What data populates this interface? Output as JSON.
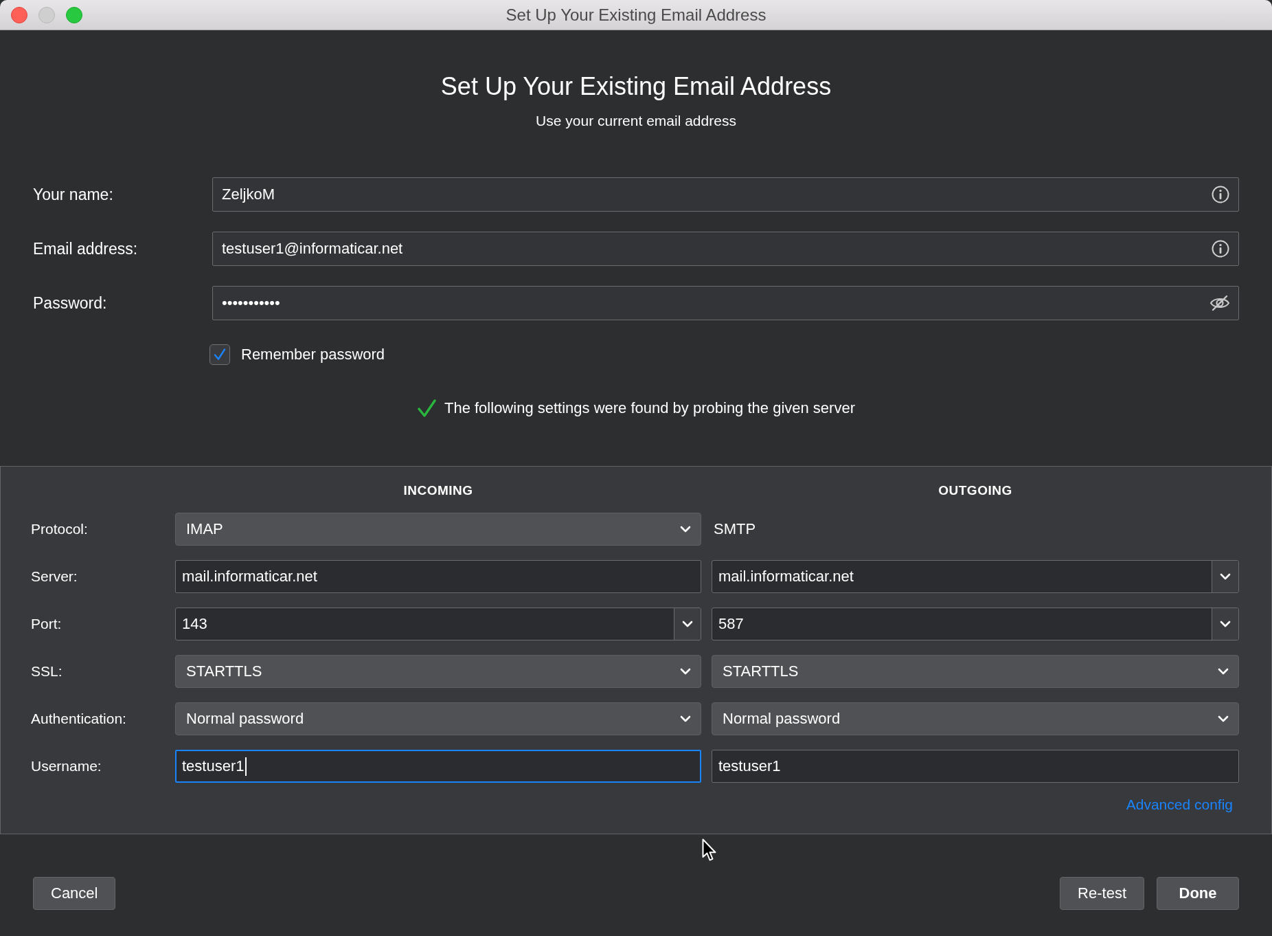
{
  "window": {
    "title": "Set Up Your Existing Email Address"
  },
  "header": {
    "title": "Set Up Your Existing Email Address",
    "subtitle": "Use your current email address"
  },
  "fields": [
    {
      "label": "Your name:",
      "kind": "text",
      "value": "ZeljkoM"
    },
    {
      "label": "Email address:",
      "kind": "text",
      "value": "testuser1@informaticar.net"
    },
    {
      "label": "Password:",
      "kind": "password",
      "value": "•••••••••••"
    }
  ],
  "remember_password": {
    "label": "Remember password",
    "checked": true
  },
  "status_message": {
    "text": "The following settings were found by probing the given server",
    "kind": "success"
  },
  "server_settings": {
    "columns": [
      {
        "heading": "INCOMING"
      },
      {
        "heading": "OUTGOING"
      }
    ],
    "rows": [
      {
        "label": "Protocol:",
        "incoming": {
          "kind": "select",
          "value": "IMAP"
        },
        "outgoing": {
          "kind": "plain",
          "value": "SMTP"
        }
      },
      {
        "label": "Server:",
        "incoming": {
          "kind": "text",
          "value": "mail.informaticar.net",
          "focused": false
        },
        "outgoing": {
          "kind": "combo",
          "value": "mail.informaticar.net"
        }
      },
      {
        "label": "Port:",
        "incoming": {
          "kind": "combo",
          "value": "143"
        },
        "outgoing": {
          "kind": "combo",
          "value": "587"
        }
      },
      {
        "label": "SSL:",
        "incoming": {
          "kind": "select",
          "value": "STARTTLS"
        },
        "outgoing": {
          "kind": "select",
          "value": "STARTTLS"
        }
      },
      {
        "label": "Authentication:",
        "incoming": {
          "kind": "select",
          "value": "Normal password"
        },
        "outgoing": {
          "kind": "select",
          "value": "Normal password"
        }
      },
      {
        "label": "Username:",
        "incoming": {
          "kind": "text",
          "value": "testuser1",
          "focused": true
        },
        "outgoing": {
          "kind": "text",
          "value": "testuser1",
          "focused": false
        }
      }
    ],
    "advanced_link": "Advanced config"
  },
  "buttons": [
    {
      "label": "Cancel",
      "default": false
    },
    {
      "label": "Re-test",
      "default": false
    },
    {
      "label": "Done",
      "default": true
    }
  ]
}
